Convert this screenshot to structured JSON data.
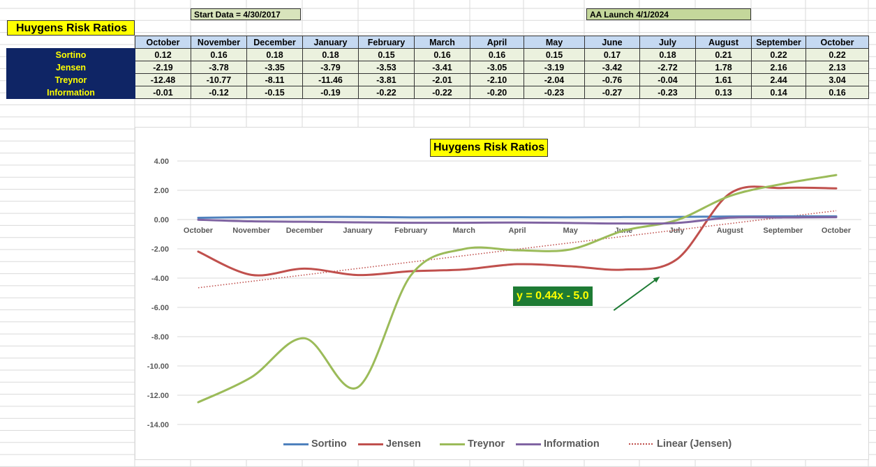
{
  "header": {
    "start_label": "Start Data = 4/30/2017",
    "launch_label": "AA Launch 4/1/2024",
    "sheet_title": "Huygens Risk Ratios"
  },
  "table": {
    "columns": [
      "October",
      "November",
      "December",
      "January",
      "February",
      "March",
      "April",
      "May",
      "June",
      "July",
      "August",
      "September",
      "October"
    ],
    "rows": [
      {
        "name": "Sortino",
        "values": [
          "0.12",
          "0.16",
          "0.18",
          "0.18",
          "0.15",
          "0.16",
          "0.16",
          "0.15",
          "0.17",
          "0.18",
          "0.21",
          "0.22",
          "0.22"
        ]
      },
      {
        "name": "Jensen",
        "values": [
          "-2.19",
          "-3.78",
          "-3.35",
          "-3.79",
          "-3.53",
          "-3.41",
          "-3.05",
          "-3.19",
          "-3.42",
          "-2.72",
          "1.78",
          "2.16",
          "2.13"
        ]
      },
      {
        "name": "Treynor",
        "values": [
          "-12.48",
          "-10.77",
          "-8.11",
          "-11.46",
          "-3.81",
          "-2.01",
          "-2.10",
          "-2.04",
          "-0.76",
          "-0.04",
          "1.61",
          "2.44",
          "3.04"
        ]
      },
      {
        "name": "Information",
        "values": [
          "-0.01",
          "-0.12",
          "-0.15",
          "-0.19",
          "-0.22",
          "-0.22",
          "-0.20",
          "-0.23",
          "-0.27",
          "-0.23",
          "0.13",
          "0.14",
          "0.16"
        ]
      }
    ]
  },
  "chart_data": {
    "type": "line",
    "title": "Huygens Risk Ratios",
    "categories": [
      "October",
      "November",
      "December",
      "January",
      "February",
      "March",
      "April",
      "May",
      "June",
      "July",
      "August",
      "September",
      "October"
    ],
    "ylim": [
      -14,
      4
    ],
    "yticks": [
      "4.00",
      "2.00",
      "0.00",
      "-2.00",
      "-4.00",
      "-6.00",
      "-8.00",
      "-10.00",
      "-12.00",
      "-14.00"
    ],
    "ytick_values": [
      4,
      2,
      0,
      -2,
      -4,
      -6,
      -8,
      -10,
      -12,
      -14
    ],
    "grid": true,
    "legend_position": "bottom",
    "series": [
      {
        "name": "Sortino",
        "color": "#4f81bd",
        "values": [
          0.12,
          0.16,
          0.18,
          0.18,
          0.15,
          0.16,
          0.16,
          0.15,
          0.17,
          0.18,
          0.21,
          0.22,
          0.22
        ]
      },
      {
        "name": "Jensen",
        "color": "#c0504d",
        "values": [
          -2.19,
          -3.78,
          -3.35,
          -3.79,
          -3.53,
          -3.41,
          -3.05,
          -3.19,
          -3.42,
          -2.72,
          1.78,
          2.16,
          2.13
        ]
      },
      {
        "name": "Treynor",
        "color": "#9bbb59",
        "values": [
          -12.48,
          -10.77,
          -8.11,
          -11.46,
          -3.81,
          -2.01,
          -2.1,
          -2.04,
          -0.76,
          -0.04,
          1.61,
          2.44,
          3.04
        ]
      },
      {
        "name": "Information",
        "color": "#8064a2",
        "values": [
          -0.01,
          -0.12,
          -0.15,
          -0.19,
          -0.22,
          -0.22,
          -0.2,
          -0.23,
          -0.27,
          -0.23,
          0.13,
          0.14,
          0.16
        ]
      }
    ],
    "trendline": {
      "name": "Linear (Jensen)",
      "color": "#c0504d",
      "style": "dotted"
    },
    "annotation": {
      "text": "y = 0.44x - 5.0",
      "background": "#1e7b34",
      "text_color": "#ffff00",
      "arrow_color": "#1e7b34"
    }
  }
}
